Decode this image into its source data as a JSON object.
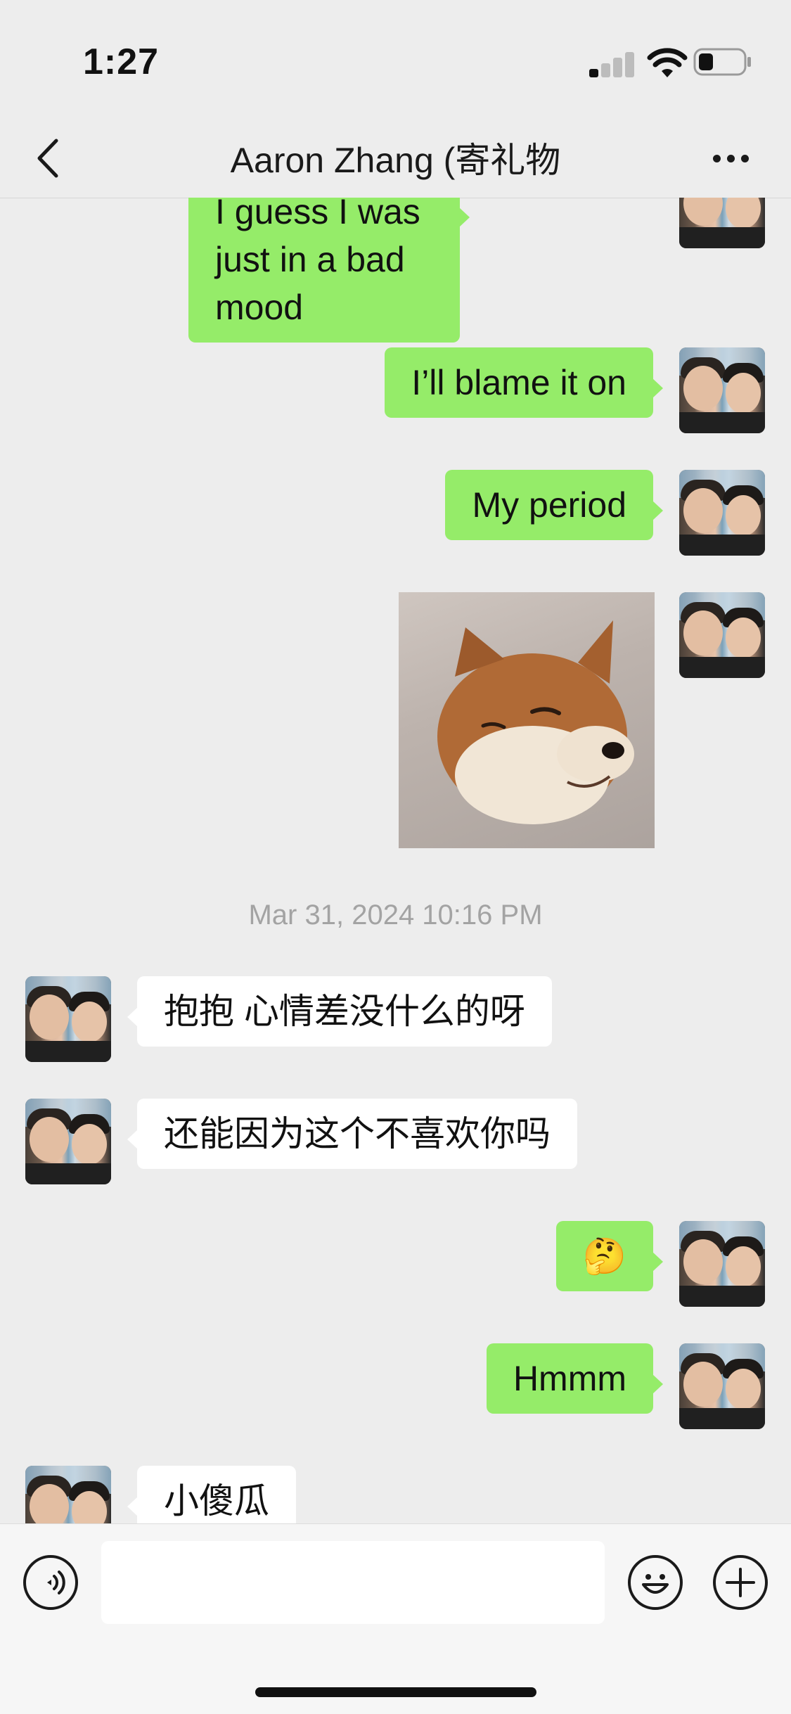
{
  "status_bar": {
    "time": "1:27"
  },
  "nav": {
    "title": "Aaron Zhang (寄礼物"
  },
  "messages": [
    {
      "text": "I guess I was just in a bad\nmood"
    },
    {
      "text": "I’ll blame it on"
    },
    {
      "text": "My period"
    },
    {
      "text": "🤔"
    },
    {
      "text": "Hmmm"
    }
  ],
  "received": [
    {
      "text": "抱抱 心情差没什么的呀"
    },
    {
      "text": "还能因为这个不喜欢你吗"
    },
    {
      "text": "小傻瓜"
    }
  ],
  "timestamp": "Mar 31, 2024 10:16 PM",
  "colors": {
    "sent_bubble": "#95ec69",
    "received_bubble": "#ffffff",
    "background": "#ededed"
  },
  "icons": {
    "back": "chevron-left-icon",
    "more": "more-dots-icon",
    "voice": "voice-icon",
    "emoji": "emoji-icon",
    "add": "plus-icon"
  }
}
